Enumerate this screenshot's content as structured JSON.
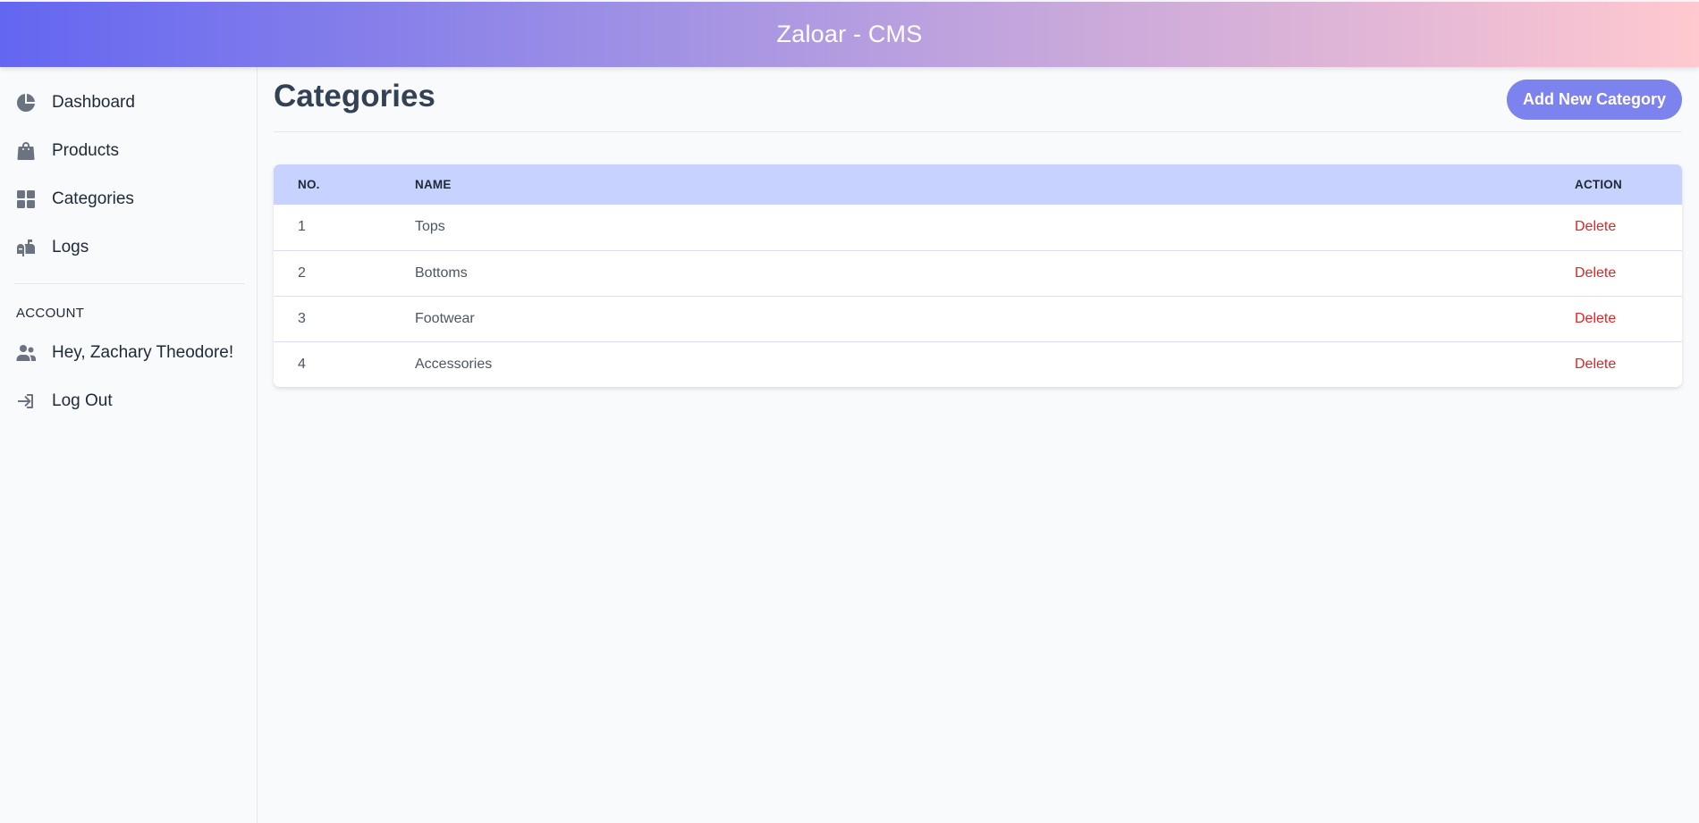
{
  "header": {
    "title": "Zaloar - CMS"
  },
  "sidebar": {
    "items": [
      {
        "label": "Dashboard",
        "icon": "chart-pie-icon"
      },
      {
        "label": "Products",
        "icon": "shopping-bag-icon"
      },
      {
        "label": "Categories",
        "icon": "grid-icon"
      },
      {
        "label": "Logs",
        "icon": "mailbox-icon"
      }
    ],
    "account_heading": "ACCOUNT",
    "account_items": [
      {
        "label": "Hey, Zachary Theodore!",
        "icon": "users-icon"
      },
      {
        "label": "Log Out",
        "icon": "sign-in-icon"
      }
    ]
  },
  "main": {
    "title": "Categories",
    "add_button_label": "Add New Category",
    "table": {
      "columns": [
        "NO.",
        "NAME",
        "ACTION"
      ],
      "rows": [
        {
          "no": "1",
          "name": "Tops",
          "action": "Delete"
        },
        {
          "no": "2",
          "name": "Bottoms",
          "action": "Delete"
        },
        {
          "no": "3",
          "name": "Footwear",
          "action": "Delete"
        },
        {
          "no": "4",
          "name": "Accessories",
          "action": "Delete"
        }
      ]
    }
  },
  "colors": {
    "accent": "#7c82ee",
    "table_header_bg": "#c7d2fe",
    "delete": "#dc2626",
    "gradient_start": "#6366f1",
    "gradient_end": "#ffc9cf"
  }
}
